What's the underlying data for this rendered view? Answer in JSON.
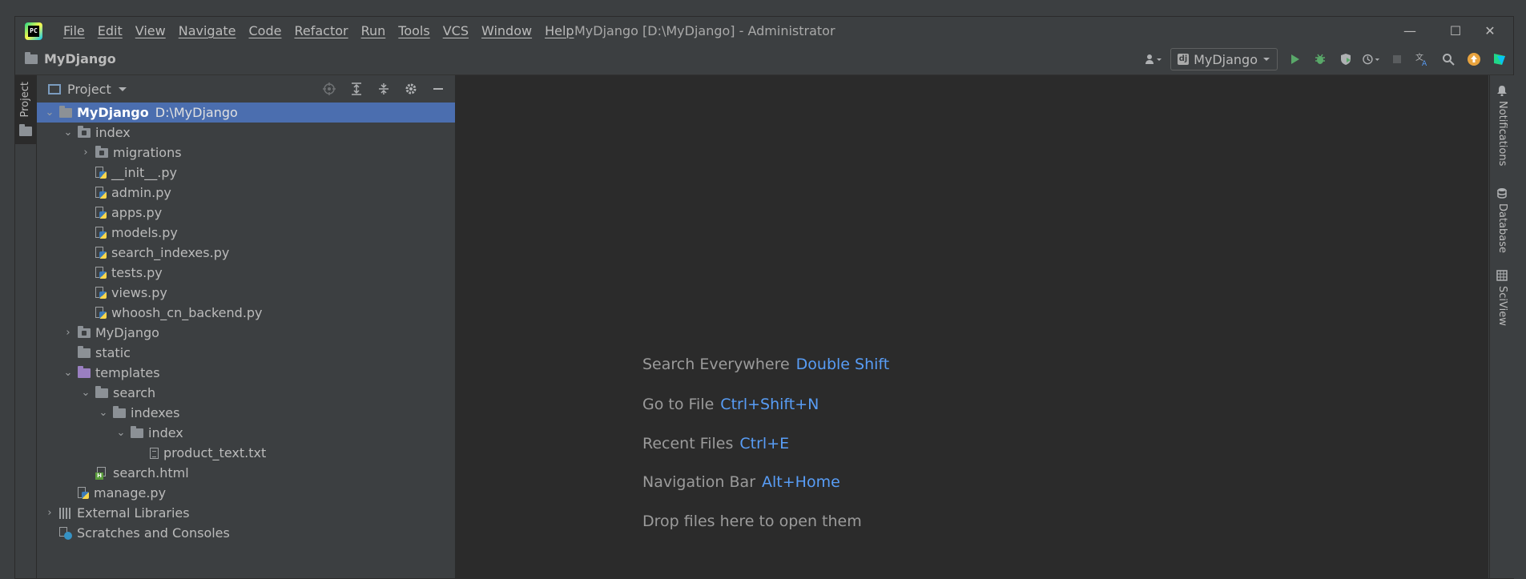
{
  "window": {
    "title": "MyDjango [D:\\MyDjango] - Administrator",
    "logo_text": "PC"
  },
  "menu": [
    "File",
    "Edit",
    "View",
    "Navigate",
    "Code",
    "Refactor",
    "Run",
    "Tools",
    "VCS",
    "Window",
    "Help"
  ],
  "window_controls": {
    "minimize": "—",
    "maximize": "☐",
    "close": "✕"
  },
  "navbar": {
    "breadcrumb": "MyDjango",
    "run_config": "MyDjango",
    "run_config_icon": "dj"
  },
  "left_stripe": {
    "project_tab": "Project"
  },
  "project_panel": {
    "title": "Project",
    "tree": {
      "root": {
        "name": "MyDjango",
        "path": "D:\\MyDjango"
      },
      "index": "index",
      "migrations": "migrations",
      "files_index": [
        "__init__.py",
        "admin.py",
        "apps.py",
        "models.py",
        "search_indexes.py",
        "tests.py",
        "views.py",
        "whoosh_cn_backend.py"
      ],
      "mydjango": "MyDjango",
      "static": "static",
      "templates": "templates",
      "search": "search",
      "indexes": "indexes",
      "index2": "index",
      "product_text": "product_text.txt",
      "search_html": "search.html",
      "manage": "manage.py",
      "external_libraries": "External Libraries",
      "scratches": "Scratches and Consoles"
    }
  },
  "editor": {
    "hints": [
      {
        "label": "Search Everywhere",
        "shortcut": "Double Shift"
      },
      {
        "label": "Go to File",
        "shortcut": "Ctrl+Shift+N"
      },
      {
        "label": "Recent Files",
        "shortcut": "Ctrl+E"
      },
      {
        "label": "Navigation Bar",
        "shortcut": "Alt+Home"
      },
      {
        "label": "Drop files here to open them",
        "shortcut": ""
      }
    ]
  },
  "right_stripe": {
    "notifications": "Notifications",
    "database": "Database",
    "sciview": "SciView"
  },
  "colors": {
    "selection": "#4b6eaf",
    "shortcut": "#589df6",
    "editor_bg": "#2b2b2b",
    "panel_bg": "#3c3f41"
  }
}
